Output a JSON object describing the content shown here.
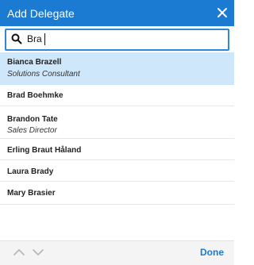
{
  "dialog": {
    "title": "Add Delegate",
    "close_icon": "close-icon"
  },
  "search": {
    "value": "Bra",
    "icon": "search-icon"
  },
  "results": [
    {
      "name": "Bianca Brazell",
      "title": "Solutions Consultant",
      "selected": true
    },
    {
      "name": "Brad Boehmke",
      "title": ""
    },
    {
      "name": "Brandon Tate",
      "title": "Sales Director"
    },
    {
      "name": "Erling Braut Håland",
      "title": ""
    },
    {
      "name": "Laura Brady",
      "title": ""
    },
    {
      "name": "Mary Brasier",
      "title": ""
    }
  ],
  "footer": {
    "prev_icon": "chevron-up-icon",
    "next_icon": "chevron-down-icon",
    "done_label": "Done"
  },
  "colors": {
    "accent": "#1b7ad1",
    "selected_row": "#cfe7fb"
  }
}
